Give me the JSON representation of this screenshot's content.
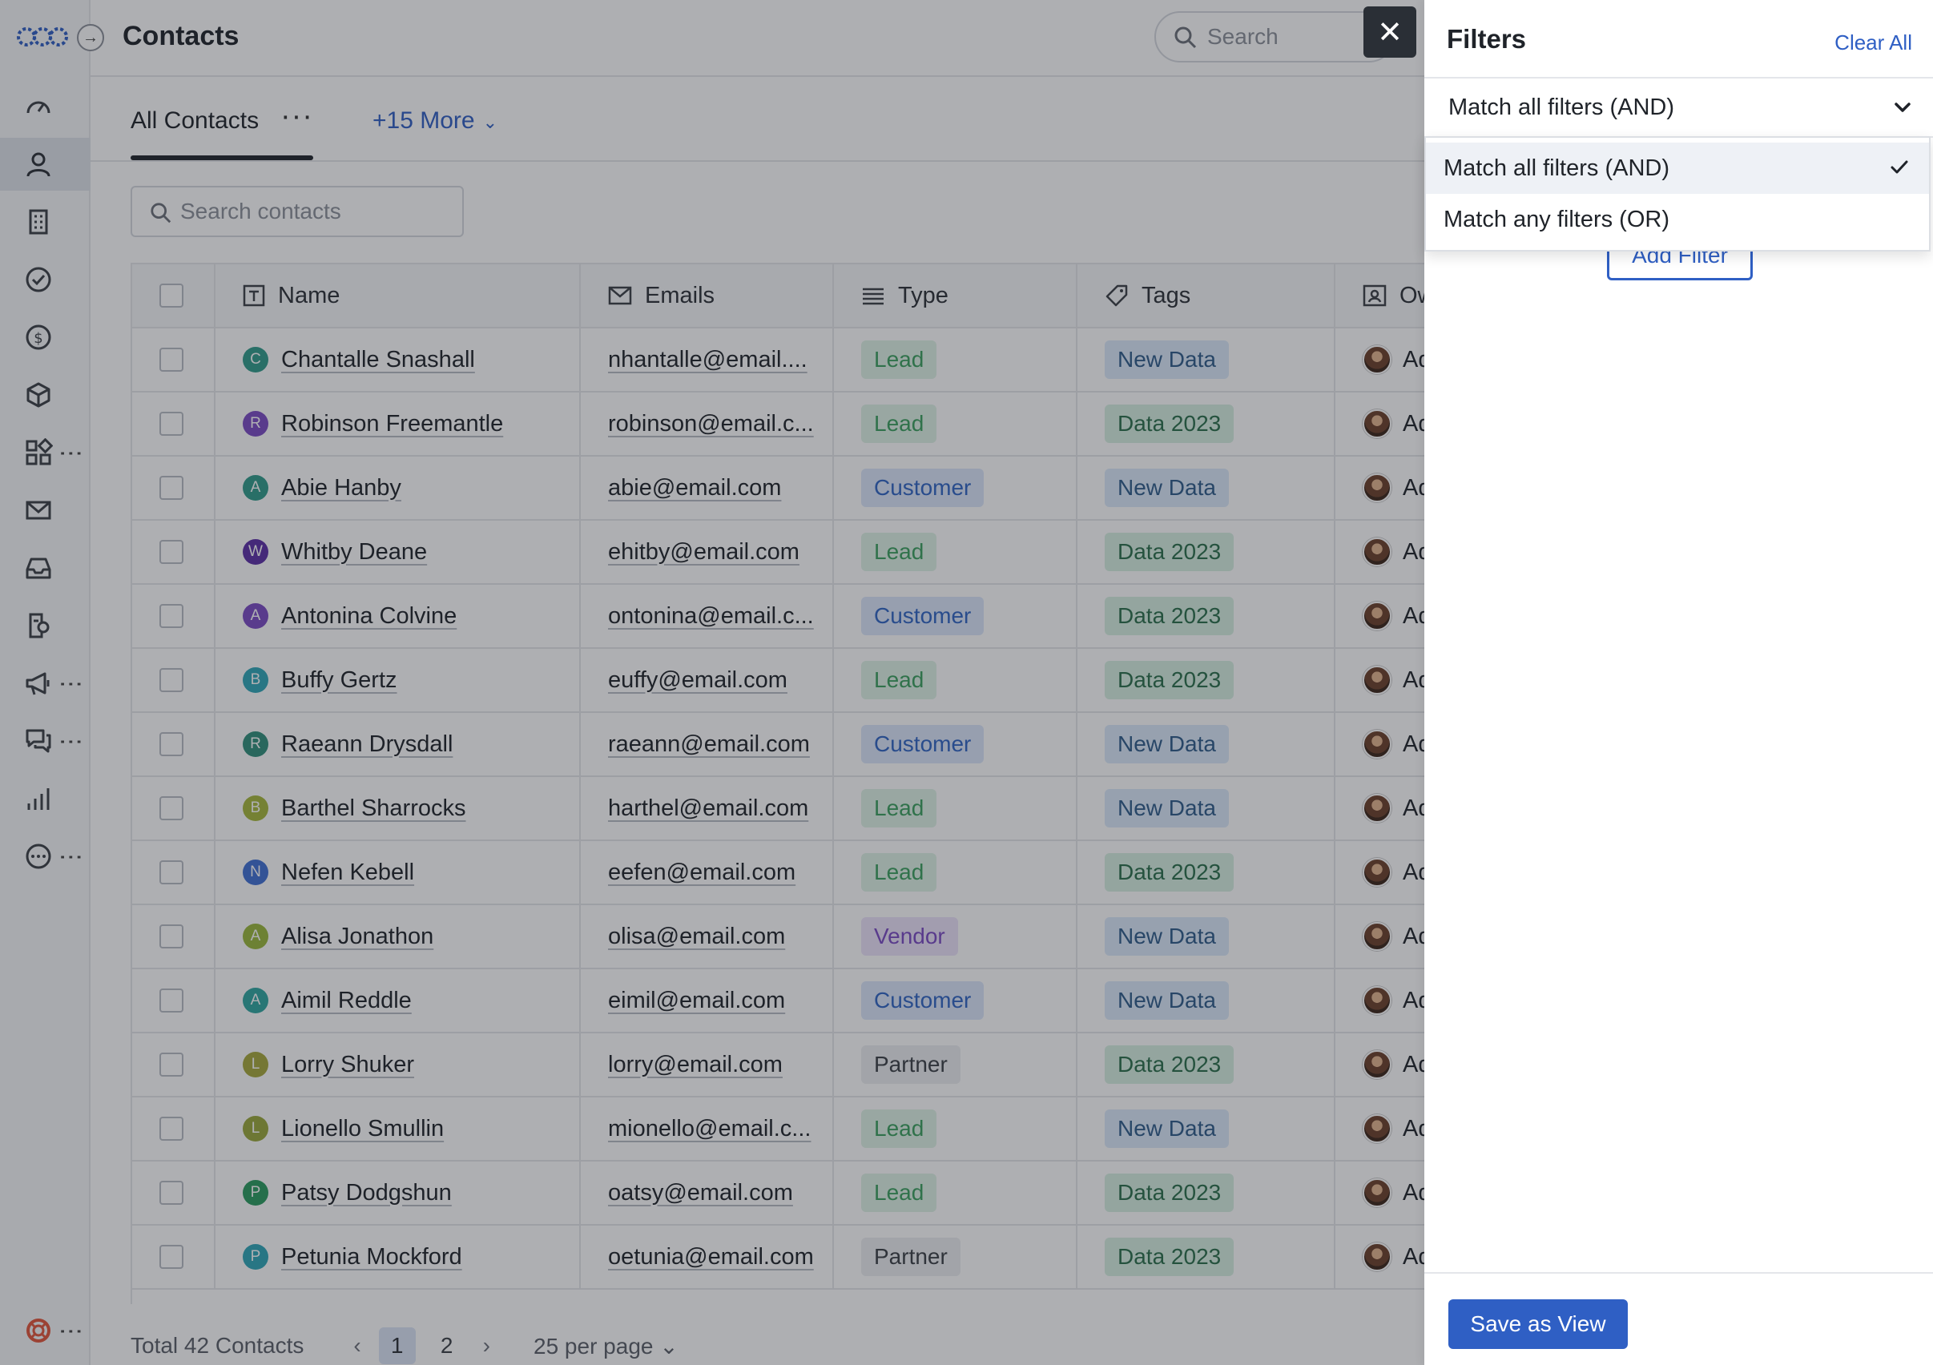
{
  "header": {
    "title": "Contacts",
    "search_placeholder": "Search"
  },
  "tabs": {
    "active_label": "All Contacts",
    "more_label": "+15 More"
  },
  "content": {
    "search_placeholder": "Search contacts"
  },
  "table": {
    "columns": [
      "Name",
      "Emails",
      "Type",
      "Tags",
      "Ow"
    ],
    "rows": [
      {
        "initial": "C",
        "color": "#2f9b8a",
        "name": "Chantalle Snashall",
        "email": "nhantalle@email....",
        "type": "Lead",
        "tag": "New Data",
        "owner": "Ad"
      },
      {
        "initial": "R",
        "color": "#7a4ac4",
        "name": "Robinson Freemantle",
        "email": "robinson@email.c...",
        "type": "Lead",
        "tag": "Data 2023",
        "owner": "Ad"
      },
      {
        "initial": "A",
        "color": "#2f9b8a",
        "name": "Abie Hanby",
        "email": "abie@email.com",
        "type": "Customer",
        "tag": "New Data",
        "owner": "Ad"
      },
      {
        "initial": "W",
        "color": "#5b2ea6",
        "name": "Whitby Deane",
        "email": "ehitby@email.com",
        "type": "Lead",
        "tag": "Data 2023",
        "owner": "Ad"
      },
      {
        "initial": "A",
        "color": "#7a4ac4",
        "name": "Antonina Colvine",
        "email": "ontonina@email.c...",
        "type": "Customer",
        "tag": "Data 2023",
        "owner": "Ad"
      },
      {
        "initial": "B",
        "color": "#2ea6b8",
        "name": "Buffy Gertz",
        "email": "euffy@email.com",
        "type": "Lead",
        "tag": "Data 2023",
        "owner": "Ad"
      },
      {
        "initial": "R",
        "color": "#2f8f7a",
        "name": "Raeann Drysdall",
        "email": "raeann@email.com",
        "type": "Customer",
        "tag": "New Data",
        "owner": "Ad"
      },
      {
        "initial": "B",
        "color": "#a6b83a",
        "name": "Barthel Sharrocks",
        "email": "harthel@email.com",
        "type": "Lead",
        "tag": "New Data",
        "owner": "Ad"
      },
      {
        "initial": "N",
        "color": "#3f6fd4",
        "name": "Nefen Kebell",
        "email": "eefen@email.com",
        "type": "Lead",
        "tag": "Data 2023",
        "owner": "Ad"
      },
      {
        "initial": "A",
        "color": "#9ab83a",
        "name": "Alisa Jonathon",
        "email": "olisa@email.com",
        "type": "Vendor",
        "tag": "New Data",
        "owner": "Ad"
      },
      {
        "initial": "A",
        "color": "#2ea6a0",
        "name": "Aimil Reddle",
        "email": "eimil@email.com",
        "type": "Customer",
        "tag": "New Data",
        "owner": "Ad"
      },
      {
        "initial": "L",
        "color": "#a6a83a",
        "name": "Lorry Shuker",
        "email": "lorry@email.com",
        "type": "Partner",
        "tag": "Data 2023",
        "owner": "Ad"
      },
      {
        "initial": "L",
        "color": "#9aa83a",
        "name": "Lionello Smullin",
        "email": "mionello@email.c...",
        "type": "Lead",
        "tag": "New Data",
        "owner": "Ad"
      },
      {
        "initial": "P",
        "color": "#2a9b5e",
        "name": "Patsy Dodgshun",
        "email": "oatsy@email.com",
        "type": "Lead",
        "tag": "Data 2023",
        "owner": "Ad"
      },
      {
        "initial": "P",
        "color": "#2ea6b8",
        "name": "Petunia Mockford",
        "email": "oetunia@email.com",
        "type": "Partner",
        "tag": "Data 2023",
        "owner": "Ad"
      }
    ]
  },
  "footer": {
    "total": "Total 42 Contacts",
    "pages": [
      "1",
      "2"
    ],
    "active_page": "1",
    "per_page": "25 per page"
  },
  "filters": {
    "title": "Filters",
    "clear_all": "Clear All",
    "match_value": "Match all filters (AND)",
    "options": [
      "Match all filters (AND)",
      "Match any filters (OR)"
    ],
    "add_filter": "Add Filter",
    "save_view": "Save as View"
  },
  "icons": {
    "nav": [
      "dashboard-icon",
      "contacts-icon",
      "companies-icon",
      "tasks-icon",
      "deals-icon",
      "products-icon",
      "apps-icon",
      "email-icon",
      "inbox-icon",
      "reports-icon",
      "campaigns-icon",
      "chat-icon",
      "analytics-icon",
      "more-icon",
      "help-icon"
    ]
  }
}
